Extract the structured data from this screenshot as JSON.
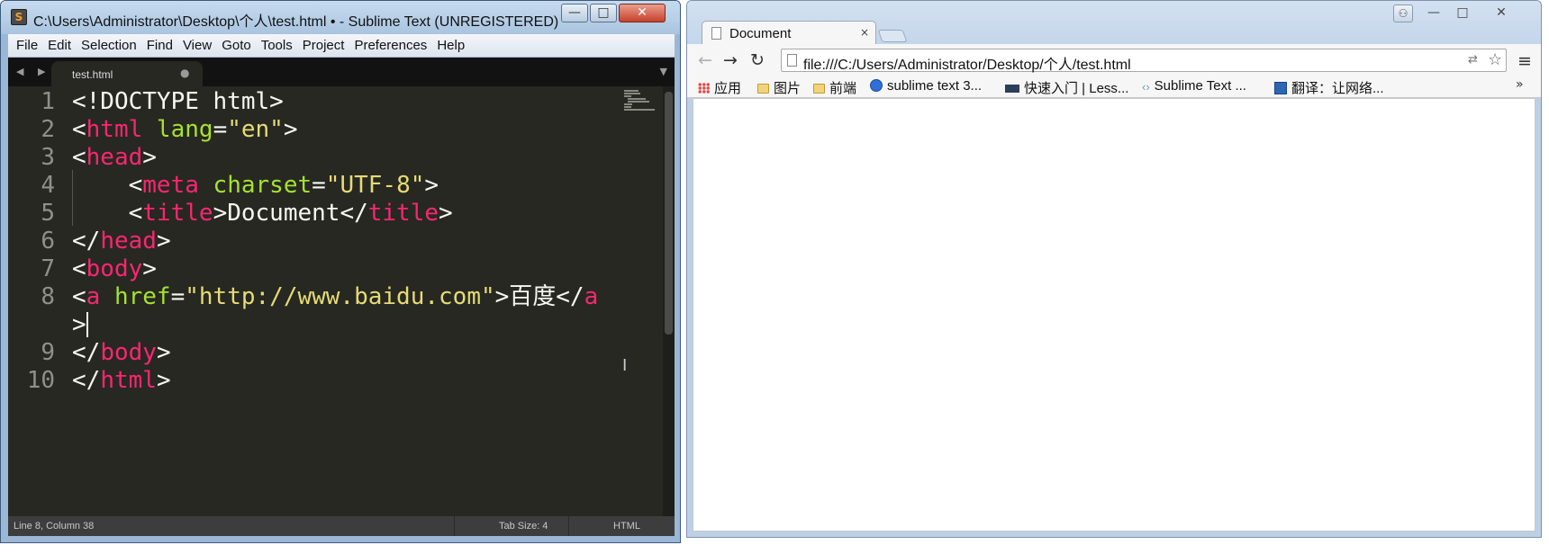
{
  "editor": {
    "window_title": "C:\\Users\\Administrator\\Desktop\\个人\\test.html • - Sublime Text (UNREGISTERED)",
    "app_icon": "S",
    "menu": [
      "File",
      "Edit",
      "Selection",
      "Find",
      "View",
      "Goto",
      "Tools",
      "Project",
      "Preferences",
      "Help"
    ],
    "tab": {
      "label": "test.html",
      "modified_dot": "●"
    },
    "tab_nav_arrows": "◀ ▶",
    "tab_dropdown": "▼",
    "line_numbers": [
      "1",
      "2",
      "3",
      "4",
      "5",
      "6",
      "7",
      "8",
      "9",
      "10"
    ],
    "code": {
      "l1": "<!DOCTYPE html>",
      "l2": {
        "p1": "<",
        "tag": "html",
        "attr": " lang",
        "eq": "=",
        "val": "\"en\"",
        "p2": ">"
      },
      "l3": {
        "p1": "<",
        "tag": "head",
        "p2": ">"
      },
      "l4": {
        "p1": "    <",
        "tag": "meta",
        "attr": " charset",
        "eq": "=",
        "val": "\"UTF-8\"",
        "p2": ">"
      },
      "l5": {
        "p1": "    <",
        "tag": "title",
        "p2": ">Document</",
        "tag2": "title",
        "p3": ">"
      },
      "l6": {
        "p1": "</",
        "tag": "head",
        "p2": ">"
      },
      "l7": {
        "p1": "<",
        "tag": "body",
        "p2": ">"
      },
      "l8": {
        "p1": "<",
        "tag": "a",
        "attr": " href",
        "eq": "=",
        "val": "\"http://www.baidu.com\"",
        "p2": ">百度</",
        "tag2": "a"
      },
      "l8b": ">",
      "l9": {
        "p1": "</",
        "tag": "body",
        "p2": ">"
      },
      "l10": {
        "p1": "</",
        "tag": "html",
        "p2": ">"
      }
    },
    "status": {
      "position": "Line 8, Column 38",
      "tab_size": "Tab Size: 4",
      "syntax": "HTML"
    },
    "colors": {
      "background": "#272822",
      "tag": "#f92672",
      "attribute": "#a6e22e",
      "string": "#e6db74",
      "text": "#f8f8f2",
      "gutter": "#8f908a"
    }
  },
  "browser": {
    "tab_title": "Document",
    "tab_close": "×",
    "url": "file:///C:/Users/Administrator/Desktop/个人/test.html",
    "icons": [
      "back-icon",
      "forward-icon",
      "reload-icon",
      "page-icon",
      "translate-icon",
      "star-icon",
      "menu-icon"
    ],
    "bookmarks": [
      {
        "label": "应用",
        "icon": "apps-icon"
      },
      {
        "label": "图片",
        "icon": "folder-icon"
      },
      {
        "label": "前端",
        "icon": "folder-icon"
      },
      {
        "label": "sublime text 3...",
        "icon": "globe-icon"
      },
      {
        "label": "快速入门 | Less...",
        "icon": "less-icon"
      },
      {
        "label": "Sublime Text ...",
        "icon": "code-icon"
      },
      {
        "label": "翻译：让网络...",
        "icon": "translate-site-icon"
      }
    ],
    "bookmarks_more": "»"
  }
}
